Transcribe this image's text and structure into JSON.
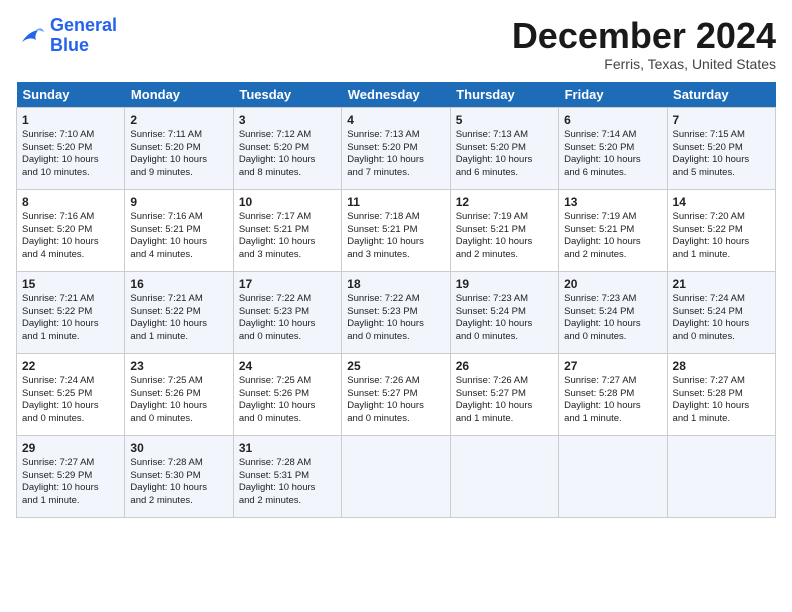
{
  "logo": {
    "line1": "General",
    "line2": "Blue"
  },
  "title": "December 2024",
  "location": "Ferris, Texas, United States",
  "days_of_week": [
    "Sunday",
    "Monday",
    "Tuesday",
    "Wednesday",
    "Thursday",
    "Friday",
    "Saturday"
  ],
  "weeks": [
    [
      {
        "day": "1",
        "info": "Sunrise: 7:10 AM\nSunset: 5:20 PM\nDaylight: 10 hours\nand 10 minutes."
      },
      {
        "day": "2",
        "info": "Sunrise: 7:11 AM\nSunset: 5:20 PM\nDaylight: 10 hours\nand 9 minutes."
      },
      {
        "day": "3",
        "info": "Sunrise: 7:12 AM\nSunset: 5:20 PM\nDaylight: 10 hours\nand 8 minutes."
      },
      {
        "day": "4",
        "info": "Sunrise: 7:13 AM\nSunset: 5:20 PM\nDaylight: 10 hours\nand 7 minutes."
      },
      {
        "day": "5",
        "info": "Sunrise: 7:13 AM\nSunset: 5:20 PM\nDaylight: 10 hours\nand 6 minutes."
      },
      {
        "day": "6",
        "info": "Sunrise: 7:14 AM\nSunset: 5:20 PM\nDaylight: 10 hours\nand 6 minutes."
      },
      {
        "day": "7",
        "info": "Sunrise: 7:15 AM\nSunset: 5:20 PM\nDaylight: 10 hours\nand 5 minutes."
      }
    ],
    [
      {
        "day": "8",
        "info": "Sunrise: 7:16 AM\nSunset: 5:20 PM\nDaylight: 10 hours\nand 4 minutes."
      },
      {
        "day": "9",
        "info": "Sunrise: 7:16 AM\nSunset: 5:21 PM\nDaylight: 10 hours\nand 4 minutes."
      },
      {
        "day": "10",
        "info": "Sunrise: 7:17 AM\nSunset: 5:21 PM\nDaylight: 10 hours\nand 3 minutes."
      },
      {
        "day": "11",
        "info": "Sunrise: 7:18 AM\nSunset: 5:21 PM\nDaylight: 10 hours\nand 3 minutes."
      },
      {
        "day": "12",
        "info": "Sunrise: 7:19 AM\nSunset: 5:21 PM\nDaylight: 10 hours\nand 2 minutes."
      },
      {
        "day": "13",
        "info": "Sunrise: 7:19 AM\nSunset: 5:21 PM\nDaylight: 10 hours\nand 2 minutes."
      },
      {
        "day": "14",
        "info": "Sunrise: 7:20 AM\nSunset: 5:22 PM\nDaylight: 10 hours\nand 1 minute."
      }
    ],
    [
      {
        "day": "15",
        "info": "Sunrise: 7:21 AM\nSunset: 5:22 PM\nDaylight: 10 hours\nand 1 minute."
      },
      {
        "day": "16",
        "info": "Sunrise: 7:21 AM\nSunset: 5:22 PM\nDaylight: 10 hours\nand 1 minute."
      },
      {
        "day": "17",
        "info": "Sunrise: 7:22 AM\nSunset: 5:23 PM\nDaylight: 10 hours\nand 0 minutes."
      },
      {
        "day": "18",
        "info": "Sunrise: 7:22 AM\nSunset: 5:23 PM\nDaylight: 10 hours\nand 0 minutes."
      },
      {
        "day": "19",
        "info": "Sunrise: 7:23 AM\nSunset: 5:24 PM\nDaylight: 10 hours\nand 0 minutes."
      },
      {
        "day": "20",
        "info": "Sunrise: 7:23 AM\nSunset: 5:24 PM\nDaylight: 10 hours\nand 0 minutes."
      },
      {
        "day": "21",
        "info": "Sunrise: 7:24 AM\nSunset: 5:24 PM\nDaylight: 10 hours\nand 0 minutes."
      }
    ],
    [
      {
        "day": "22",
        "info": "Sunrise: 7:24 AM\nSunset: 5:25 PM\nDaylight: 10 hours\nand 0 minutes."
      },
      {
        "day": "23",
        "info": "Sunrise: 7:25 AM\nSunset: 5:26 PM\nDaylight: 10 hours\nand 0 minutes."
      },
      {
        "day": "24",
        "info": "Sunrise: 7:25 AM\nSunset: 5:26 PM\nDaylight: 10 hours\nand 0 minutes."
      },
      {
        "day": "25",
        "info": "Sunrise: 7:26 AM\nSunset: 5:27 PM\nDaylight: 10 hours\nand 0 minutes."
      },
      {
        "day": "26",
        "info": "Sunrise: 7:26 AM\nSunset: 5:27 PM\nDaylight: 10 hours\nand 1 minute."
      },
      {
        "day": "27",
        "info": "Sunrise: 7:27 AM\nSunset: 5:28 PM\nDaylight: 10 hours\nand 1 minute."
      },
      {
        "day": "28",
        "info": "Sunrise: 7:27 AM\nSunset: 5:28 PM\nDaylight: 10 hours\nand 1 minute."
      }
    ],
    [
      {
        "day": "29",
        "info": "Sunrise: 7:27 AM\nSunset: 5:29 PM\nDaylight: 10 hours\nand 1 minute."
      },
      {
        "day": "30",
        "info": "Sunrise: 7:28 AM\nSunset: 5:30 PM\nDaylight: 10 hours\nand 2 minutes."
      },
      {
        "day": "31",
        "info": "Sunrise: 7:28 AM\nSunset: 5:31 PM\nDaylight: 10 hours\nand 2 minutes."
      },
      null,
      null,
      null,
      null
    ]
  ]
}
